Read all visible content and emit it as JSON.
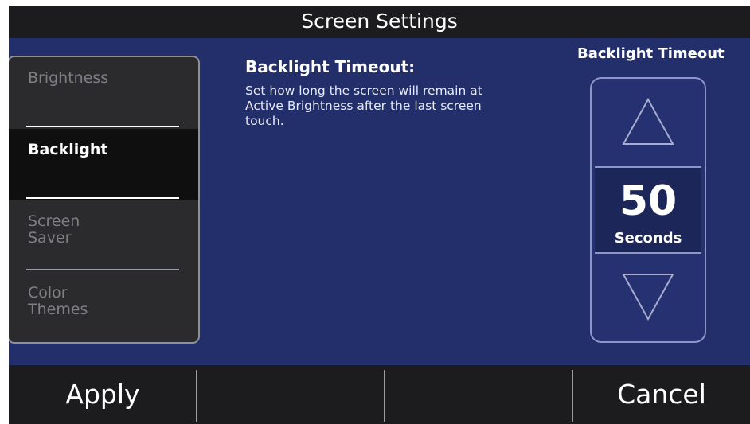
{
  "title": "Screen Settings",
  "menu": {
    "items": [
      {
        "label": "Brightness"
      },
      {
        "label": "Backlight"
      },
      {
        "label": "Screen\nSaver"
      },
      {
        "label": "Color\nThemes"
      }
    ],
    "selected": "Backlight"
  },
  "description": {
    "title": "Backlight Timeout:",
    "text": "Set how long the screen will remain at Active Brightness after the last screen touch."
  },
  "stepper": {
    "title": "Backlight Timeout",
    "value": "50",
    "unit": "Seconds",
    "up_icon": "triangle-up-icon",
    "down_icon": "triangle-down-icon"
  },
  "bottom": {
    "apply_label": "Apply",
    "cancel_label": "Cancel"
  },
  "colors": {
    "panel_background": "#232f6b",
    "bar_background": "#1c1c1e",
    "selected_item": "#0f0f10",
    "menu_background": "#2b2b2d"
  }
}
